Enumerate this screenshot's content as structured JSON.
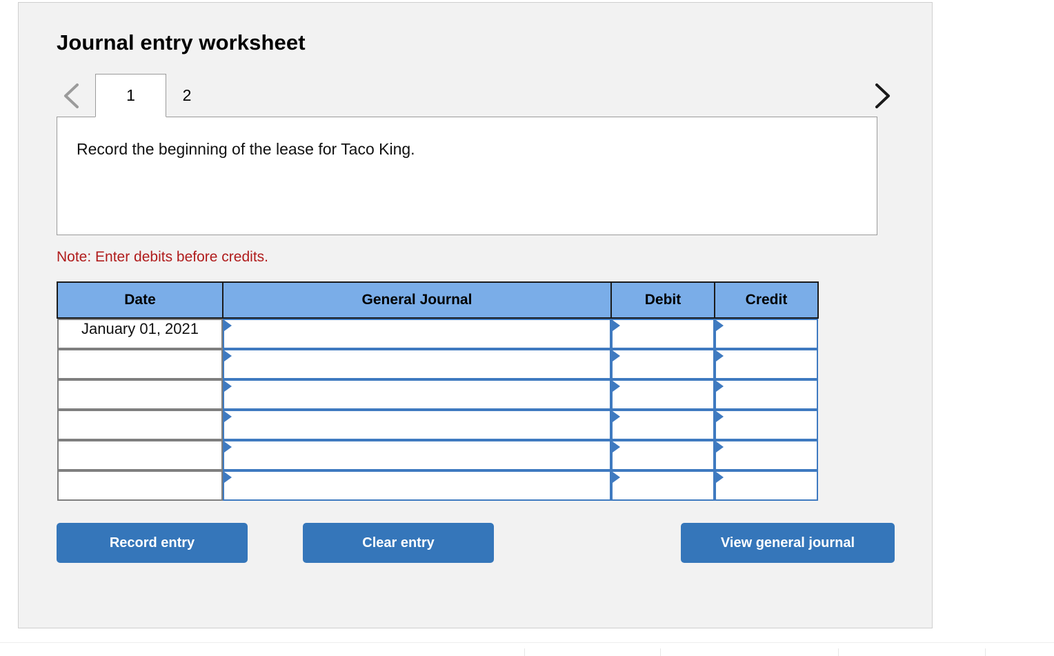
{
  "page": {
    "title": "Journal entry worksheet"
  },
  "nav": {
    "prev_icon": "chevron-left-icon",
    "next_icon": "chevron-right-icon",
    "prev_enabled": false,
    "next_enabled": true
  },
  "tabs": [
    {
      "label": "1",
      "active": true
    },
    {
      "label": "2",
      "active": false
    }
  ],
  "description": {
    "text": "Record the beginning of the lease for Taco King."
  },
  "note": {
    "text": "Note: Enter debits before credits."
  },
  "table": {
    "columns": [
      "Date",
      "General Journal",
      "Debit",
      "Credit"
    ],
    "rows": [
      {
        "date": "January 01, 2021",
        "general_journal": "",
        "debit": "",
        "credit": ""
      },
      {
        "date": "",
        "general_journal": "",
        "debit": "",
        "credit": ""
      },
      {
        "date": "",
        "general_journal": "",
        "debit": "",
        "credit": ""
      },
      {
        "date": "",
        "general_journal": "",
        "debit": "",
        "credit": ""
      },
      {
        "date": "",
        "general_journal": "",
        "debit": "",
        "credit": ""
      },
      {
        "date": "",
        "general_journal": "",
        "debit": "",
        "credit": ""
      }
    ]
  },
  "buttons": {
    "record": "Record entry",
    "clear": "Clear entry",
    "view": "View general journal"
  },
  "colors": {
    "panel_background": "#f2f2f2",
    "header_blue": "#7aade8",
    "button_blue": "#3576ba",
    "note_red": "#b01c1c",
    "input_border_blue": "#3f7ac0"
  }
}
